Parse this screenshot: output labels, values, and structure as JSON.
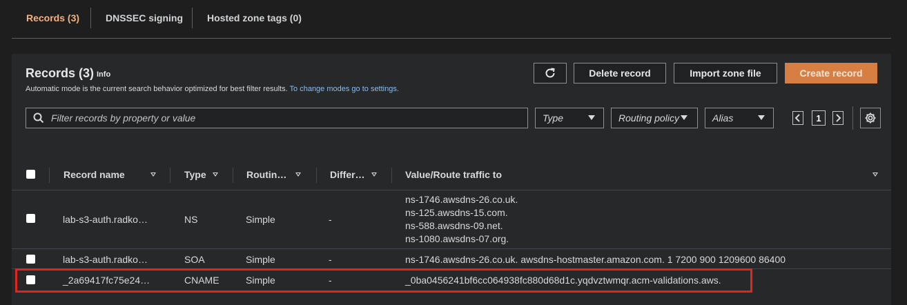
{
  "tabs": [
    {
      "label": "Records (3)",
      "active": true
    },
    {
      "label": "DNSSEC signing",
      "active": false
    },
    {
      "label": "Hosted zone tags (0)",
      "active": false
    }
  ],
  "header": {
    "title": "Records (3)",
    "info": "Info",
    "description": "Automatic mode is the current search behavior optimized for best filter results.",
    "description_link": "To change modes go to settings."
  },
  "actions": {
    "refresh_icon": "refresh-icon",
    "delete": "Delete record",
    "import": "Import zone file",
    "create": "Create record"
  },
  "filters": {
    "search_placeholder": "Filter records by property or value",
    "type": "Type",
    "routing_policy": "Routing policy",
    "alias": "Alias"
  },
  "pagination": {
    "page": "1"
  },
  "columns": [
    "Record name",
    "Type",
    "Routin…",
    "Differ…",
    "Value/Route traffic to"
  ],
  "rows": [
    {
      "name": "lab-s3-auth.radko…",
      "type": "NS",
      "routing": "Simple",
      "diff": "-",
      "values": [
        "ns-1746.awsdns-26.co.uk.",
        "ns-125.awsdns-15.com.",
        "ns-588.awsdns-09.net.",
        "ns-1080.awsdns-07.org."
      ]
    },
    {
      "name": "lab-s3-auth.radko…",
      "type": "SOA",
      "routing": "Simple",
      "diff": "-",
      "values": [
        "ns-1746.awsdns-26.co.uk. awsdns-hostmaster.amazon.com. 1 7200 900 1209600 86400"
      ]
    },
    {
      "name": "_2a69417fc75e24…",
      "type": "CNAME",
      "routing": "Simple",
      "diff": "-",
      "values": [
        "_0ba0456241bf6cc064938fc880d68d1c.yqdvztwmqr.acm-validations.aws."
      ]
    }
  ],
  "colors": {
    "accent": "#d77f42",
    "active_tab": "#f3b283",
    "link": "#89bdf2",
    "highlight": "#e0261f"
  }
}
